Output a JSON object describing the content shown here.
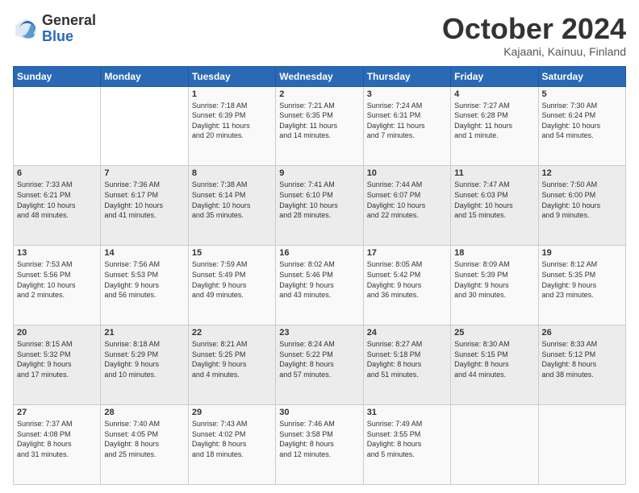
{
  "header": {
    "logo_general": "General",
    "logo_blue": "Blue",
    "month_title": "October 2024",
    "location": "Kajaani, Kainuu, Finland"
  },
  "weekdays": [
    "Sunday",
    "Monday",
    "Tuesday",
    "Wednesday",
    "Thursday",
    "Friday",
    "Saturday"
  ],
  "weeks": [
    [
      {
        "day": "",
        "info": ""
      },
      {
        "day": "",
        "info": ""
      },
      {
        "day": "1",
        "info": "Sunrise: 7:18 AM\nSunset: 6:39 PM\nDaylight: 11 hours\nand 20 minutes."
      },
      {
        "day": "2",
        "info": "Sunrise: 7:21 AM\nSunset: 6:35 PM\nDaylight: 11 hours\nand 14 minutes."
      },
      {
        "day": "3",
        "info": "Sunrise: 7:24 AM\nSunset: 6:31 PM\nDaylight: 11 hours\nand 7 minutes."
      },
      {
        "day": "4",
        "info": "Sunrise: 7:27 AM\nSunset: 6:28 PM\nDaylight: 11 hours\nand 1 minute."
      },
      {
        "day": "5",
        "info": "Sunrise: 7:30 AM\nSunset: 6:24 PM\nDaylight: 10 hours\nand 54 minutes."
      }
    ],
    [
      {
        "day": "6",
        "info": "Sunrise: 7:33 AM\nSunset: 6:21 PM\nDaylight: 10 hours\nand 48 minutes."
      },
      {
        "day": "7",
        "info": "Sunrise: 7:36 AM\nSunset: 6:17 PM\nDaylight: 10 hours\nand 41 minutes."
      },
      {
        "day": "8",
        "info": "Sunrise: 7:38 AM\nSunset: 6:14 PM\nDaylight: 10 hours\nand 35 minutes."
      },
      {
        "day": "9",
        "info": "Sunrise: 7:41 AM\nSunset: 6:10 PM\nDaylight: 10 hours\nand 28 minutes."
      },
      {
        "day": "10",
        "info": "Sunrise: 7:44 AM\nSunset: 6:07 PM\nDaylight: 10 hours\nand 22 minutes."
      },
      {
        "day": "11",
        "info": "Sunrise: 7:47 AM\nSunset: 6:03 PM\nDaylight: 10 hours\nand 15 minutes."
      },
      {
        "day": "12",
        "info": "Sunrise: 7:50 AM\nSunset: 6:00 PM\nDaylight: 10 hours\nand 9 minutes."
      }
    ],
    [
      {
        "day": "13",
        "info": "Sunrise: 7:53 AM\nSunset: 5:56 PM\nDaylight: 10 hours\nand 2 minutes."
      },
      {
        "day": "14",
        "info": "Sunrise: 7:56 AM\nSunset: 5:53 PM\nDaylight: 9 hours\nand 56 minutes."
      },
      {
        "day": "15",
        "info": "Sunrise: 7:59 AM\nSunset: 5:49 PM\nDaylight: 9 hours\nand 49 minutes."
      },
      {
        "day": "16",
        "info": "Sunrise: 8:02 AM\nSunset: 5:46 PM\nDaylight: 9 hours\nand 43 minutes."
      },
      {
        "day": "17",
        "info": "Sunrise: 8:05 AM\nSunset: 5:42 PM\nDaylight: 9 hours\nand 36 minutes."
      },
      {
        "day": "18",
        "info": "Sunrise: 8:09 AM\nSunset: 5:39 PM\nDaylight: 9 hours\nand 30 minutes."
      },
      {
        "day": "19",
        "info": "Sunrise: 8:12 AM\nSunset: 5:35 PM\nDaylight: 9 hours\nand 23 minutes."
      }
    ],
    [
      {
        "day": "20",
        "info": "Sunrise: 8:15 AM\nSunset: 5:32 PM\nDaylight: 9 hours\nand 17 minutes."
      },
      {
        "day": "21",
        "info": "Sunrise: 8:18 AM\nSunset: 5:29 PM\nDaylight: 9 hours\nand 10 minutes."
      },
      {
        "day": "22",
        "info": "Sunrise: 8:21 AM\nSunset: 5:25 PM\nDaylight: 9 hours\nand 4 minutes."
      },
      {
        "day": "23",
        "info": "Sunrise: 8:24 AM\nSunset: 5:22 PM\nDaylight: 8 hours\nand 57 minutes."
      },
      {
        "day": "24",
        "info": "Sunrise: 8:27 AM\nSunset: 5:18 PM\nDaylight: 8 hours\nand 51 minutes."
      },
      {
        "day": "25",
        "info": "Sunrise: 8:30 AM\nSunset: 5:15 PM\nDaylight: 8 hours\nand 44 minutes."
      },
      {
        "day": "26",
        "info": "Sunrise: 8:33 AM\nSunset: 5:12 PM\nDaylight: 8 hours\nand 38 minutes."
      }
    ],
    [
      {
        "day": "27",
        "info": "Sunrise: 7:37 AM\nSunset: 4:08 PM\nDaylight: 8 hours\nand 31 minutes."
      },
      {
        "day": "28",
        "info": "Sunrise: 7:40 AM\nSunset: 4:05 PM\nDaylight: 8 hours\nand 25 minutes."
      },
      {
        "day": "29",
        "info": "Sunrise: 7:43 AM\nSunset: 4:02 PM\nDaylight: 8 hours\nand 18 minutes."
      },
      {
        "day": "30",
        "info": "Sunrise: 7:46 AM\nSunset: 3:58 PM\nDaylight: 8 hours\nand 12 minutes."
      },
      {
        "day": "31",
        "info": "Sunrise: 7:49 AM\nSunset: 3:55 PM\nDaylight: 8 hours\nand 5 minutes."
      },
      {
        "day": "",
        "info": ""
      },
      {
        "day": "",
        "info": ""
      }
    ]
  ]
}
